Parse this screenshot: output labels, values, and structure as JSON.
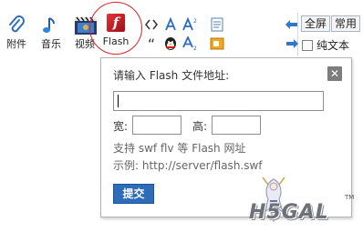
{
  "toolbar": {
    "attachment_label": "附件",
    "music_label": "音乐",
    "video_label": "视频",
    "flash_label": "Flash",
    "flash_tile_glyph": "f",
    "quote_glyph": "“",
    "fullscreen_label": "全屏",
    "common_label": "常用",
    "plaintext_label": "纯文本",
    "plaintext_checked": false
  },
  "flash_popup": {
    "title": "请输入 Flash 文件地址:",
    "url_value": "",
    "width_label": "宽:",
    "width_value": "",
    "height_label": "高:",
    "height_value": "",
    "hint_support": "支持 swf flv 等 Flash 网址",
    "hint_example": "示例: http://server/flash.swf",
    "submit_label": "提交",
    "close_glyph": "✕"
  },
  "watermark": {
    "text": "H5GAL",
    "tm": "TM"
  },
  "colors": {
    "highlight_circle": "#d9232c",
    "submit_bg": "#2c6cb9",
    "close_bg": "#7d7d7d"
  }
}
